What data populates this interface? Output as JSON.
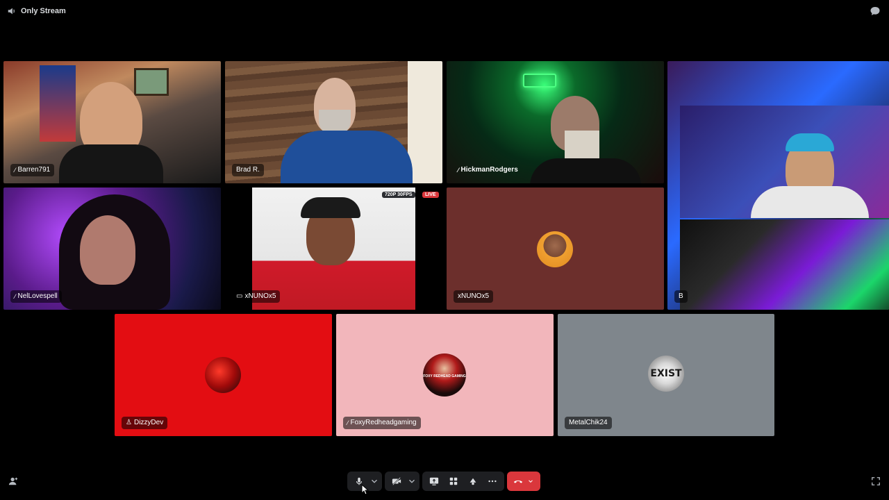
{
  "app": {
    "channel_title": "Only Stream"
  },
  "participants": {
    "barren": {
      "name": "Barren791",
      "muted": true
    },
    "brad": {
      "name": "Brad R."
    },
    "hickman": {
      "name": "HickmanRodgers",
      "muted": true
    },
    "right_stream": {
      "name_partial": "B"
    },
    "nell": {
      "name": "NelLovespell",
      "muted": true
    },
    "xnuno_stream": {
      "name": "xNUNOx5",
      "quality_badge": "720P 30FPS",
      "live_badge": "LIVE"
    },
    "xnuno_cam": {
      "name": "xNUNOx5"
    },
    "dizzy": {
      "name": "DizzyDev",
      "platform_icon": "playstation-icon",
      "tile_color": "#e30d12"
    },
    "foxy": {
      "name": "FoxyRedheadgaming",
      "muted": true,
      "tile_color": "#f2b6bb",
      "avatar_text": "FOXY REDHEAD GAMING"
    },
    "metal": {
      "name": "MetalChik24",
      "tile_color": "#7f868c",
      "avatar_text": "EXIST"
    }
  },
  "colors": {
    "accent_end_call": "#da373c",
    "control_bg": "#1e1f22",
    "xnuno_cam_bg": "#6c2f2c"
  }
}
